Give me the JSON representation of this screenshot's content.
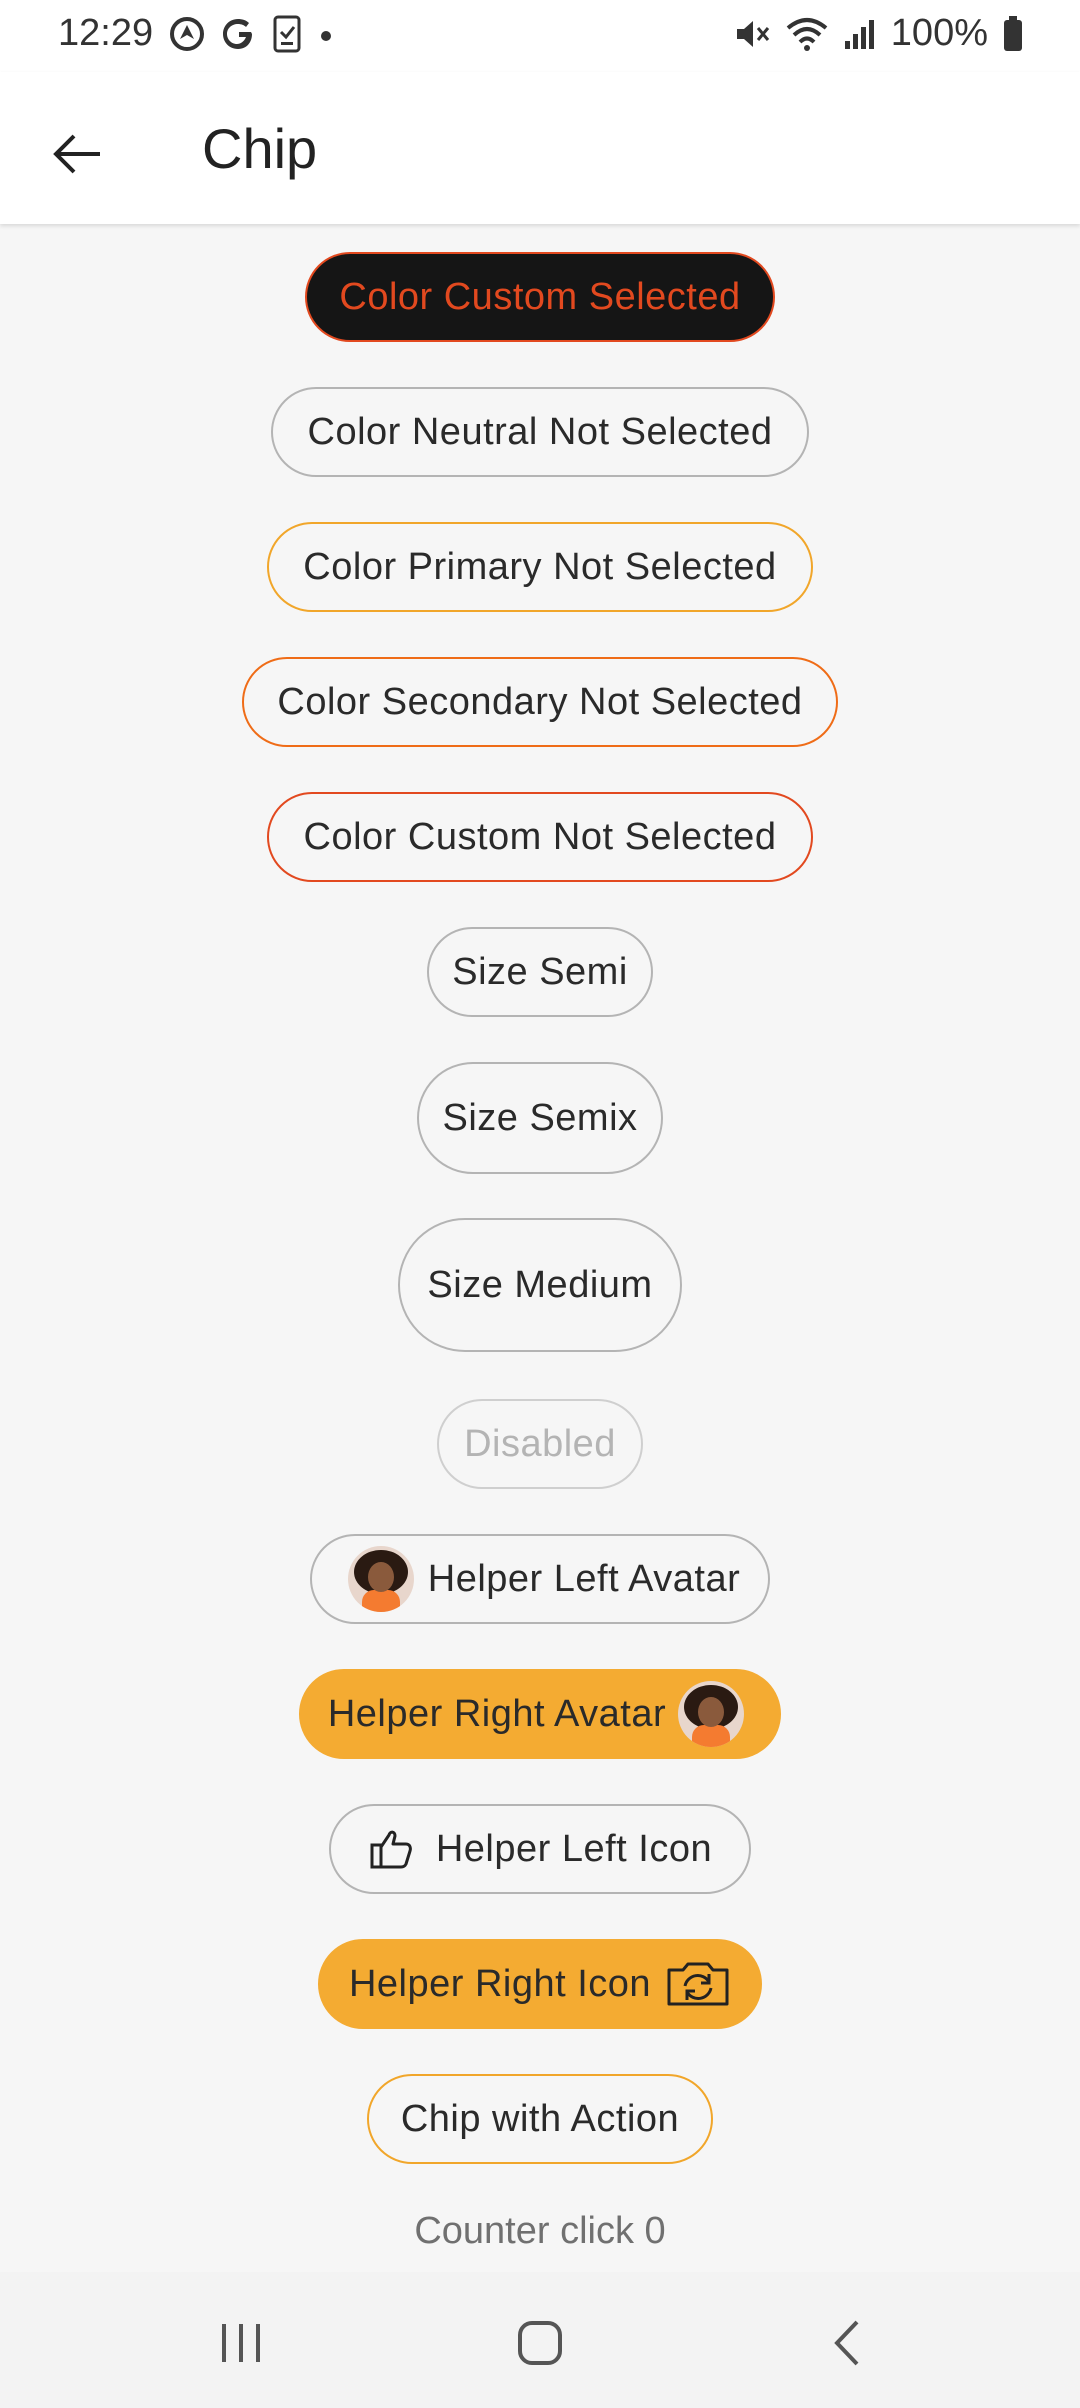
{
  "status_bar": {
    "time": "12:29",
    "left_icons": [
      "location-icon",
      "google-icon",
      "clipboard-check-icon",
      "dot-icon"
    ],
    "right_icons": [
      "mute-icon",
      "wifi-icon",
      "signal-icon",
      "battery-icon"
    ],
    "battery": "100%"
  },
  "app_bar": {
    "title": "Chip",
    "back_icon": "arrow-left-icon"
  },
  "chips": {
    "color_custom_selected": "Color Custom Selected",
    "color_neutral_not_selected": "Color Neutral Not Selected",
    "color_primary_not_selected": "Color Primary Not Selected",
    "color_secondary_not_selected": "Color Secondary Not Selected",
    "color_custom_not_selected": "Color Custom Not Selected",
    "size_semi": "Size Semi",
    "size_semix": "Size Semix",
    "size_medium": "Size Medium",
    "disabled": "Disabled",
    "helper_left_avatar": "Helper Left Avatar",
    "helper_right_avatar": "Helper Right Avatar",
    "helper_left_icon": "Helper Left Icon",
    "helper_right_icon": "Helper Right Icon",
    "chip_with_action": "Chip with Action"
  },
  "counter": "Counter click 0",
  "nav_bar": [
    "recent-apps-icon",
    "home-icon",
    "back-icon"
  ],
  "colors": {
    "custom": "#e2491f",
    "primary": "#f1a62a",
    "secondary": "#ef6c17",
    "filled": "#f4ab32",
    "neutral": "#b4b4b4"
  }
}
